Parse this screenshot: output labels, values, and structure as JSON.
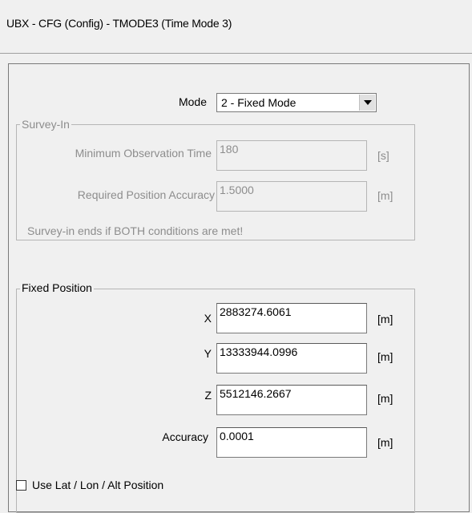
{
  "window": {
    "title": "UBX - CFG (Config) - TMODE3 (Time Mode 3)"
  },
  "mode": {
    "label": "Mode",
    "selected": "2 - Fixed Mode"
  },
  "survey_in": {
    "legend": "Survey-In",
    "min_obs_time": {
      "label": "Minimum Observation Time",
      "value": "180",
      "unit": "[s]"
    },
    "req_pos_accuracy": {
      "label": "Required Position Accuracy",
      "value": "1.5000",
      "unit": "[m]"
    },
    "note": "Survey-in ends if BOTH conditions are met!"
  },
  "fixed_position": {
    "legend": "Fixed Position",
    "x": {
      "label": "X",
      "value": "2883274.6061",
      "unit": "[m]"
    },
    "y": {
      "label": "Y",
      "value": "13333944.0996",
      "unit": "[m]"
    },
    "z": {
      "label": "Z",
      "value": "5512146.2667",
      "unit": "[m]"
    },
    "accuracy": {
      "label": "Accuracy",
      "value": "0.0001",
      "unit": "[m]"
    }
  },
  "use_lla": {
    "label": "Use Lat / Lon / Alt Position",
    "checked": false
  }
}
